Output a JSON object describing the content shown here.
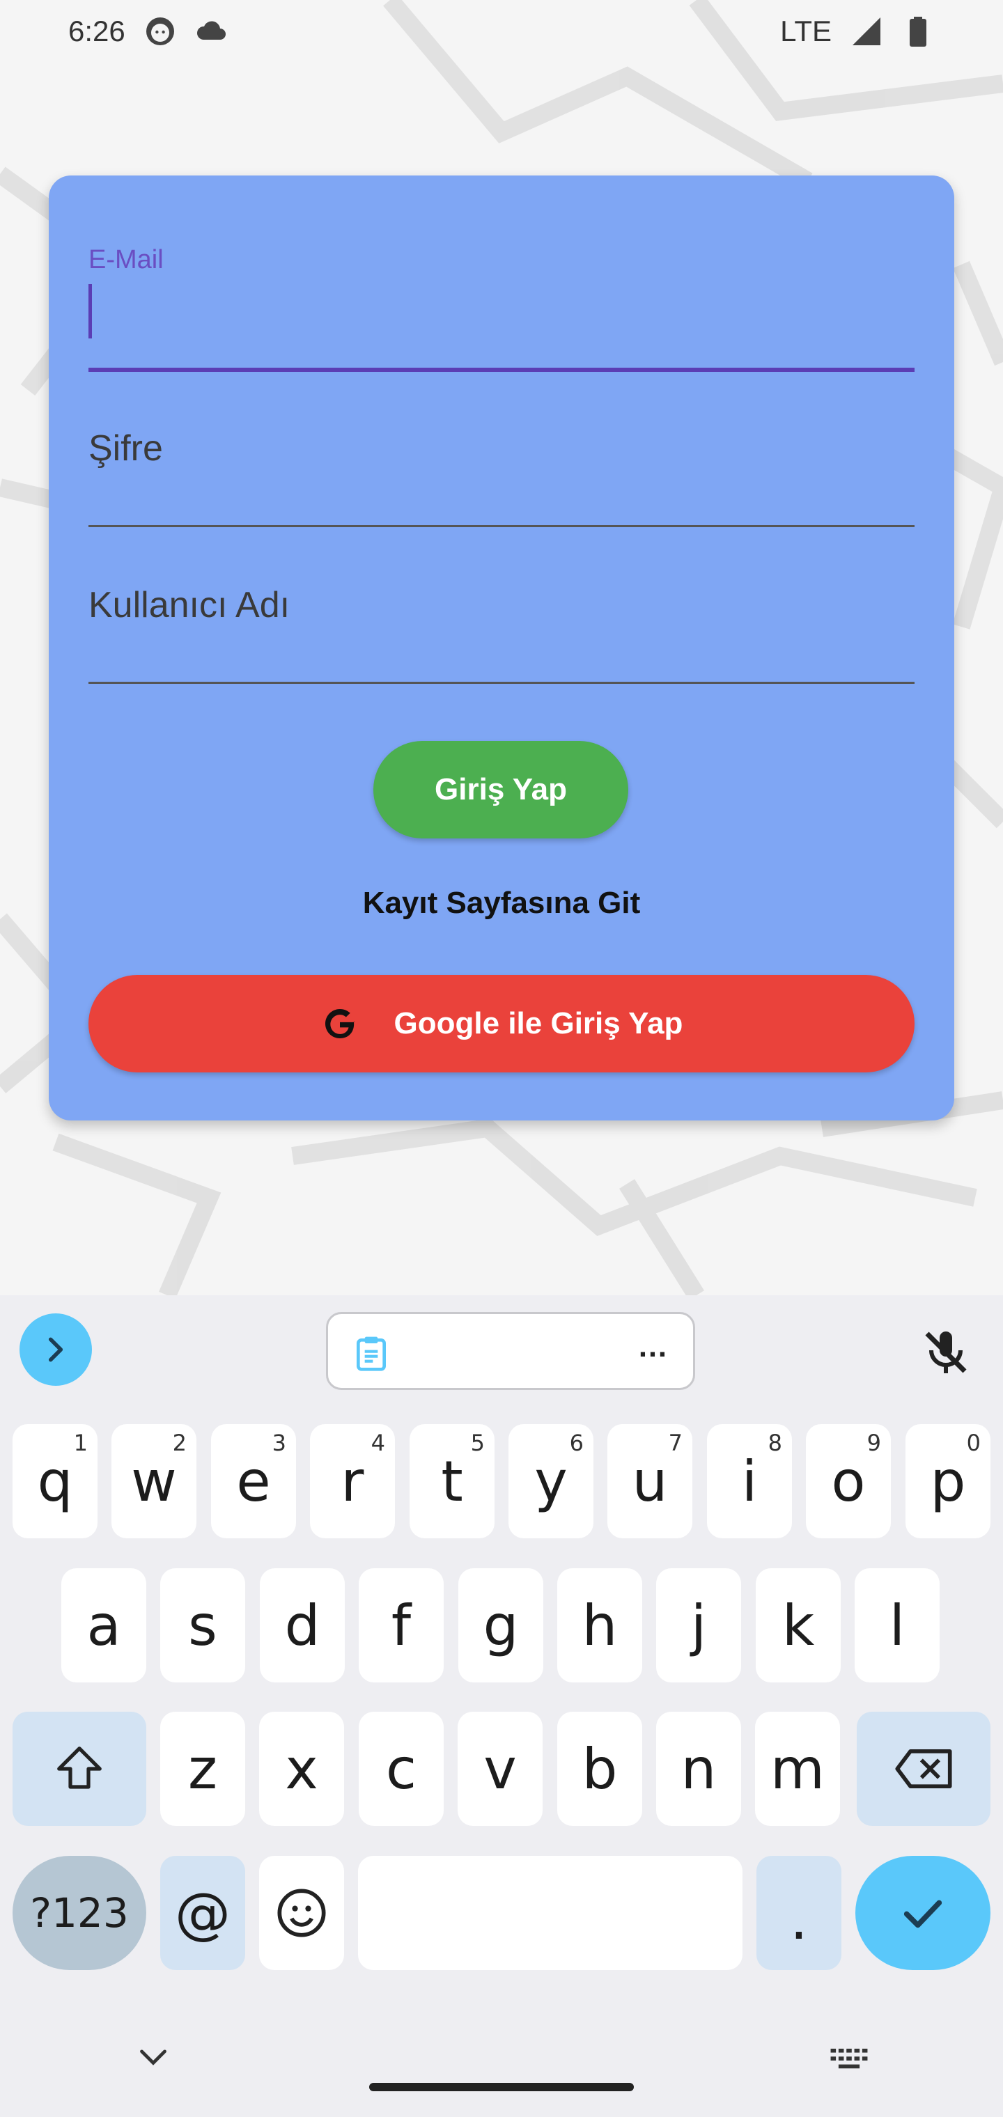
{
  "status_bar": {
    "time": "6:26",
    "network": "LTE",
    "icons": [
      "face-icon",
      "cloud-icon",
      "signal-icon",
      "battery-icon"
    ]
  },
  "form": {
    "email_label": "E-Mail",
    "email_value": "",
    "password_placeholder": "Şifre",
    "username_placeholder": "Kullanıcı Adı",
    "login_button": "Giriş Yap",
    "register_link": "Kayıt Sayfasına Git",
    "google_button": "Google ile Giriş Yap"
  },
  "keyboard": {
    "row1": [
      {
        "key": "q",
        "hint": "1"
      },
      {
        "key": "w",
        "hint": "2"
      },
      {
        "key": "e",
        "hint": "3"
      },
      {
        "key": "r",
        "hint": "4"
      },
      {
        "key": "t",
        "hint": "5"
      },
      {
        "key": "y",
        "hint": "6"
      },
      {
        "key": "u",
        "hint": "7"
      },
      {
        "key": "i",
        "hint": "8"
      },
      {
        "key": "o",
        "hint": "9"
      },
      {
        "key": "p",
        "hint": "0"
      }
    ],
    "row2": [
      "a",
      "s",
      "d",
      "f",
      "g",
      "h",
      "j",
      "k",
      "l"
    ],
    "row3": [
      "z",
      "x",
      "c",
      "v",
      "b",
      "n",
      "m"
    ],
    "symbols_label": "?123",
    "at_label": "@",
    "period_label": ".",
    "clipboard_more": "…"
  },
  "colors": {
    "card": "#7fa6f4",
    "login_button": "#4caf50",
    "google_button": "#ea423b",
    "focus": "#5b3db4",
    "keyboard_accent": "#5ac8fa"
  }
}
